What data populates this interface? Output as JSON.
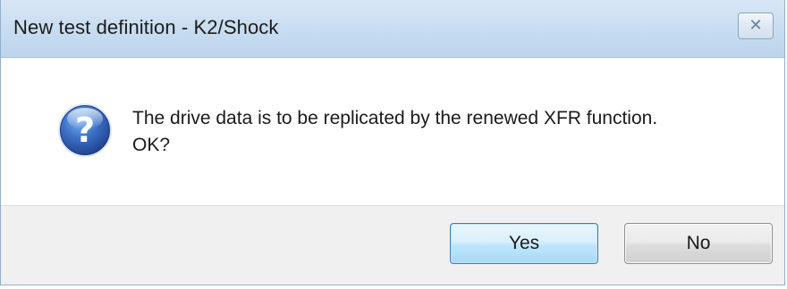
{
  "dialog": {
    "title": "New test definition - K2/Shock",
    "close_symbol": "✕",
    "icon": "question-icon",
    "icon_symbol": "?",
    "message_line1": "The drive data is to be replicated by the renewed XFR function.",
    "message_line2": "OK?",
    "buttons": {
      "yes_label": "Yes",
      "no_label": "No"
    }
  },
  "colors": {
    "title_bar": "#c7dcf0",
    "footer": "#f0f0f0",
    "icon_blue": "#2f5fb5",
    "default_button_border": "#3c7fb1"
  }
}
